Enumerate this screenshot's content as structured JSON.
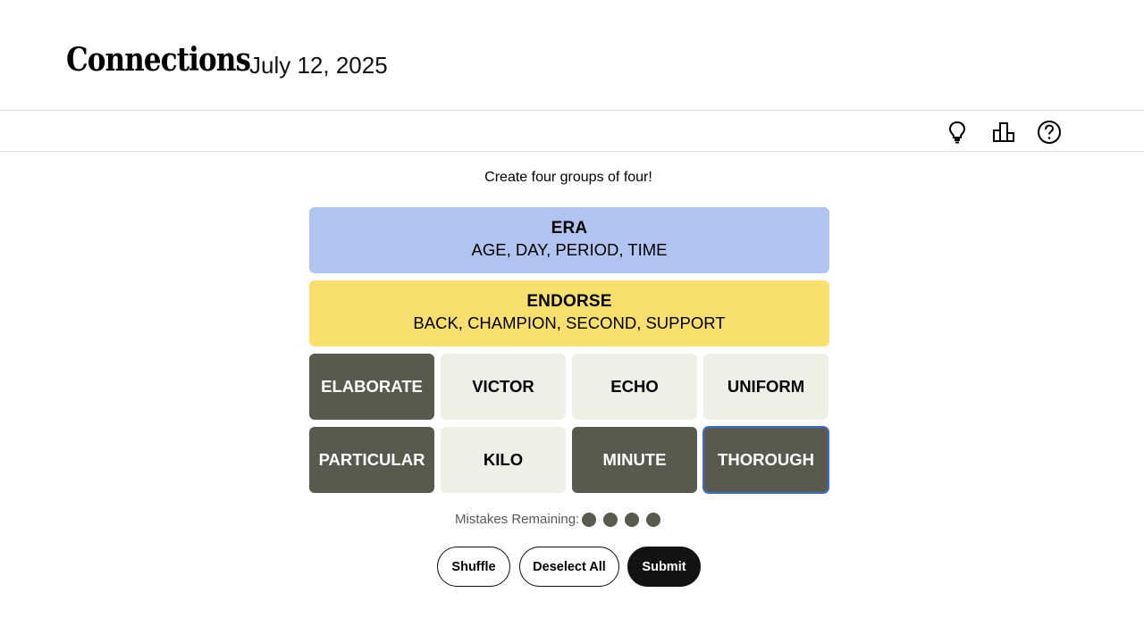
{
  "header": {
    "title": "Connections",
    "date": "July 12, 2025"
  },
  "toolbar": {
    "icons": [
      "lightbulb-icon",
      "leaderboard-icon",
      "help-icon"
    ]
  },
  "instructions": "Create four groups of four!",
  "solved_groups": [
    {
      "name": "ERA",
      "words": "AGE, DAY, PERIOD, TIME",
      "color": "#b0c4ef"
    },
    {
      "name": "ENDORSE",
      "words": "BACK, CHAMPION, SECOND, SUPPORT",
      "color": "#f9df6d"
    }
  ],
  "tiles": [
    {
      "word": "ELABORATE",
      "selected": true
    },
    {
      "word": "VICTOR",
      "selected": false
    },
    {
      "word": "ECHO",
      "selected": false
    },
    {
      "word": "UNIFORM",
      "selected": false
    },
    {
      "word": "PARTICULAR",
      "selected": true
    },
    {
      "word": "KILO",
      "selected": false
    },
    {
      "word": "MINUTE",
      "selected": true
    },
    {
      "word": "THOROUGH",
      "selected": true
    }
  ],
  "mistakes": {
    "label": "Mistakes Remaining:",
    "remaining": 4
  },
  "buttons": {
    "shuffle": "Shuffle",
    "deselect": "Deselect All",
    "submit": "Submit"
  },
  "colors": {
    "selected_tile": "#5a594e",
    "unselected_tile": "#efefe6",
    "focus_outline": "#3a6fc7"
  }
}
